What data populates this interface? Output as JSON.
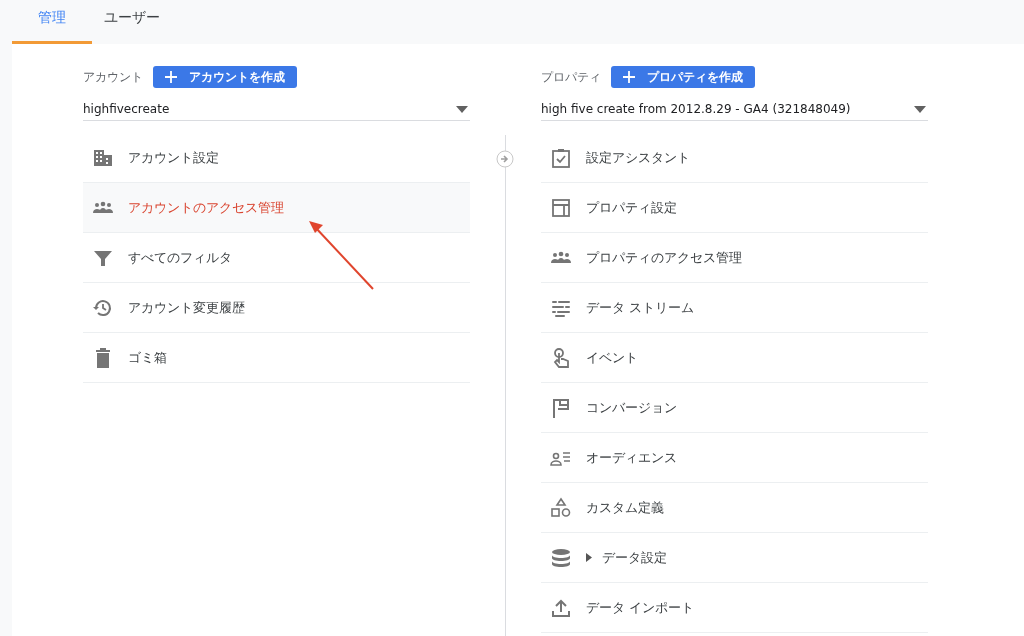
{
  "tabs": [
    {
      "label": "管理",
      "selected": true
    },
    {
      "label": "ユーザー",
      "selected": false
    }
  ],
  "account": {
    "label": "アカウント",
    "create_button": "アカウントを作成",
    "dropdown_value": "highfivecreate",
    "items": [
      {
        "label": "アカウント設定",
        "highlighted": false
      },
      {
        "label": "アカウントのアクセス管理",
        "highlighted": true
      },
      {
        "label": "すべてのフィルタ",
        "highlighted": false
      },
      {
        "label": "アカウント変更履歴",
        "highlighted": false
      },
      {
        "label": "ゴミ箱",
        "highlighted": false
      }
    ]
  },
  "property": {
    "label": "プロパティ",
    "create_button": "プロパティを作成",
    "dropdown_value": "high five create from 2012.8.29 - GA4 (321848049)",
    "items": [
      {
        "label": "設定アシスタント",
        "kind": "item"
      },
      {
        "label": "プロパティ設定",
        "kind": "item"
      },
      {
        "label": "プロパティのアクセス管理",
        "kind": "item"
      },
      {
        "label": "データ ストリーム",
        "kind": "item"
      },
      {
        "label": "イベント",
        "kind": "item"
      },
      {
        "label": "コンバージョン",
        "kind": "item"
      },
      {
        "label": "オーディエンス",
        "kind": "item"
      },
      {
        "label": "カスタム定義",
        "kind": "item"
      },
      {
        "label": "データ設定",
        "kind": "group"
      },
      {
        "label": "データ インポート",
        "kind": "item"
      }
    ]
  }
}
